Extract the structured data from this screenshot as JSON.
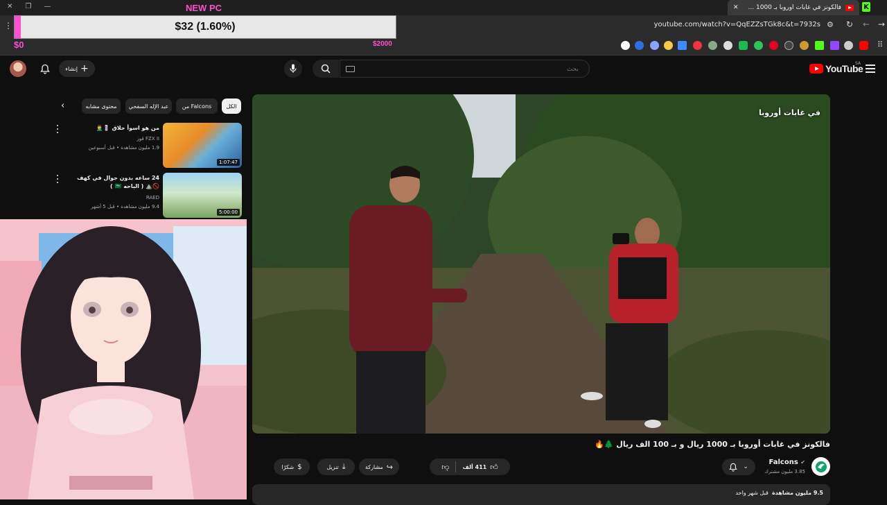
{
  "browser": {
    "tab_title": "فالكونز في غابات أوروبا بـ 1000 ...",
    "url": "youtube.com/watch?v=QqEZZsTGk8c&t=7932s"
  },
  "donation_goal": {
    "title": "NEW PC",
    "current_text": "$32 (1.60%)",
    "progress_fraction": 0.016,
    "min_label": "$0",
    "max_label": "$2000"
  },
  "header": {
    "logo_text": "YouTube",
    "country_code": "SA",
    "search_placeholder": "بحث",
    "create_label": "إنشاء"
  },
  "chips": [
    {
      "label": "الكل",
      "active": true
    },
    {
      "label": "من Falcons",
      "active": false
    },
    {
      "label": "عبد الإله السفحي",
      "active": false
    },
    {
      "label": "محتوى مشابه",
      "active": false
    }
  ],
  "recommendations": [
    {
      "title": "من هو اسوأ حلاق 💈🤦‍♂️",
      "channel": "FZX II قوز",
      "meta": "1.9 مليون مشاهدة • قبل أسبوعين",
      "duration": "1:07:47"
    },
    {
      "title": "24 ساعه بدون جوال في كهف 🚫⛰️ ( الباحه 🇸🇦 )",
      "channel": "RAED",
      "meta": "9.4 مليون مشاهدة • قبل 5 أشهر",
      "duration": "5:00:00"
    }
  ],
  "video": {
    "title": "فالكونز في غابات أوروبا بـ 1000 ريال و بـ 100 الف ريال 🌲🔥",
    "overlay_logo_text": "في غابات أوروبا"
  },
  "channel": {
    "name": "Falcons",
    "subscribers": "3.85 مليون مشترك"
  },
  "actions": {
    "like_count": "411 ألف",
    "share_label": "مشاركة",
    "download_label": "تنزيل",
    "thanks_label": "شكرًا"
  },
  "description": {
    "views": "9.5 مليون مشاهدة",
    "date": "قبل شهر واحد"
  }
}
